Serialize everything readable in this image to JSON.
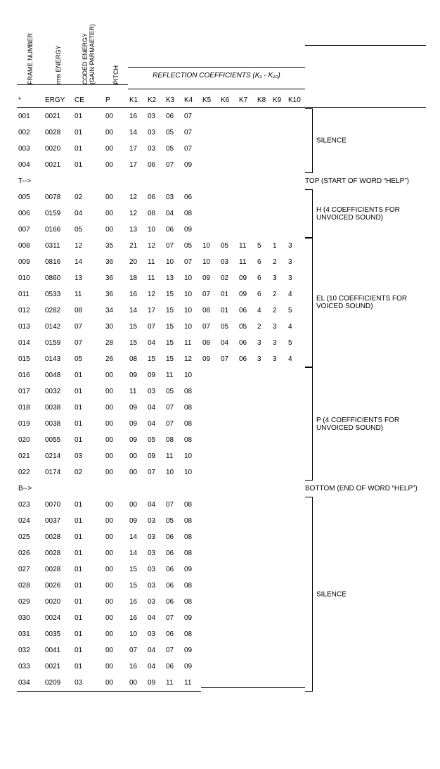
{
  "headers": {
    "frame": "FRAME NUMBER",
    "ergy": "rms ENERGY",
    "ce": "CODED ENERGY\n(GAIN PARMAETER)",
    "pitch": "PITCH",
    "refl": "REFLECTION COEFFICIENTS  (K₁ - K₁₀)",
    "sub": {
      "frame": "*",
      "ergy": "ERGY",
      "ce": "CE",
      "p": "P"
    },
    "k": [
      "K1",
      "K2",
      "K3",
      "K4",
      "K5",
      "K6",
      "K7",
      "K8",
      "K9",
      "K10"
    ]
  },
  "sections": [
    {
      "label": "SILENCE",
      "rows": [
        {
          "f": "001",
          "e": "0021",
          "c": "01",
          "p": "00",
          "k": [
            "16",
            "03",
            "06",
            "07"
          ]
        },
        {
          "f": "002",
          "e": "0028",
          "c": "01",
          "p": "00",
          "k": [
            "14",
            "03",
            "05",
            "07"
          ]
        },
        {
          "f": "003",
          "e": "0020",
          "c": "01",
          "p": "00",
          "k": [
            "17",
            "03",
            "05",
            "07"
          ]
        },
        {
          "f": "004",
          "e": "0021",
          "c": "01",
          "p": "00",
          "k": [
            "17",
            "06",
            "07",
            "09"
          ]
        }
      ]
    },
    {
      "marker": {
        "left": "T-->",
        "right": "TOP (START OF WORD “HELP”)"
      }
    },
    {
      "label": "H (4 COEFFICIENTS FOR UNVOICED SOUND)",
      "rows": [
        {
          "f": "005",
          "e": "0078",
          "c": "02",
          "p": "00",
          "k": [
            "12",
            "06",
            "03",
            "06"
          ]
        },
        {
          "f": "006",
          "e": "0159",
          "c": "04",
          "p": "00",
          "k": [
            "12",
            "08",
            "04",
            "08"
          ]
        },
        {
          "f": "007",
          "e": "0166",
          "c": "05",
          "p": "00",
          "k": [
            "13",
            "10",
            "06",
            "09"
          ]
        }
      ]
    },
    {
      "label": "EL (10 COEFFICIENTS FOR VOICED SOUND)",
      "rows": [
        {
          "f": "008",
          "e": "0311",
          "c": "12",
          "p": "35",
          "k": [
            "21",
            "12",
            "07",
            "05",
            "10",
            "05",
            "11",
            "5",
            "1",
            "3"
          ]
        },
        {
          "f": "009",
          "e": "0816",
          "c": "14",
          "p": "36",
          "k": [
            "20",
            "11",
            "10",
            "07",
            "10",
            "03",
            "11",
            "6",
            "2",
            "3"
          ]
        },
        {
          "f": "010",
          "e": "0860",
          "c": "13",
          "p": "36",
          "k": [
            "18",
            "11",
            "13",
            "10",
            "09",
            "02",
            "09",
            "6",
            "3",
            "3"
          ]
        },
        {
          "f": "011",
          "e": "0533",
          "c": "11",
          "p": "36",
          "k": [
            "16",
            "12",
            "15",
            "10",
            "07",
            "01",
            "09",
            "6",
            "2",
            "4"
          ]
        },
        {
          "f": "012",
          "e": "0282",
          "c": "08",
          "p": "34",
          "k": [
            "14",
            "17",
            "15",
            "10",
            "08",
            "01",
            "06",
            "4",
            "2",
            "5"
          ]
        },
        {
          "f": "013",
          "e": "0142",
          "c": "07",
          "p": "30",
          "k": [
            "15",
            "07",
            "15",
            "10",
            "07",
            "05",
            "05",
            "2",
            "3",
            "4"
          ]
        },
        {
          "f": "014",
          "e": "0159",
          "c": "07",
          "p": "28",
          "k": [
            "15",
            "04",
            "15",
            "11",
            "08",
            "04",
            "06",
            "3",
            "3",
            "5"
          ]
        },
        {
          "f": "015",
          "e": "0143",
          "c": "05",
          "p": "26",
          "k": [
            "08",
            "15",
            "15",
            "12",
            "09",
            "07",
            "06",
            "3",
            "3",
            "4"
          ]
        }
      ]
    },
    {
      "label": "P (4 COEFFICIENTS FOR UNVOICED SOUND)",
      "rows": [
        {
          "f": "016",
          "e": "0048",
          "c": "01",
          "p": "00",
          "k": [
            "09",
            "09",
            "11",
            "10"
          ]
        },
        {
          "f": "017",
          "e": "0032",
          "c": "01",
          "p": "00",
          "k": [
            "11",
            "03",
            "05",
            "08"
          ]
        },
        {
          "f": "018",
          "e": "0038",
          "c": "01",
          "p": "00",
          "k": [
            "09",
            "04",
            "07",
            "08"
          ]
        },
        {
          "f": "019",
          "e": "0038",
          "c": "01",
          "p": "00",
          "k": [
            "09",
            "04",
            "07",
            "08"
          ]
        },
        {
          "f": "020",
          "e": "0055",
          "c": "01",
          "p": "00",
          "k": [
            "09",
            "05",
            "08",
            "08"
          ]
        },
        {
          "f": "021",
          "e": "0214",
          "c": "03",
          "p": "00",
          "k": [
            "00",
            "09",
            "11",
            "10"
          ]
        },
        {
          "f": "022",
          "e": "0174",
          "c": "02",
          "p": "00",
          "k": [
            "00",
            "07",
            "10",
            "10"
          ]
        }
      ]
    },
    {
      "marker": {
        "left": "B-->",
        "right": "BOTTOM (END OF WORD “HELP”)"
      }
    },
    {
      "label": "SILENCE",
      "rows": [
        {
          "f": "023",
          "e": "0070",
          "c": "01",
          "p": "00",
          "k": [
            "00",
            "04",
            "07",
            "08"
          ]
        },
        {
          "f": "024",
          "e": "0037",
          "c": "01",
          "p": "00",
          "k": [
            "09",
            "03",
            "05",
            "08"
          ]
        },
        {
          "f": "025",
          "e": "0028",
          "c": "01",
          "p": "00",
          "k": [
            "14",
            "03",
            "06",
            "08"
          ]
        },
        {
          "f": "026",
          "e": "0028",
          "c": "01",
          "p": "00",
          "k": [
            "14",
            "03",
            "06",
            "08"
          ]
        },
        {
          "f": "027",
          "e": "0028",
          "c": "01",
          "p": "00",
          "k": [
            "15",
            "03",
            "06",
            "09"
          ]
        },
        {
          "f": "028",
          "e": "0026",
          "c": "01",
          "p": "00",
          "k": [
            "15",
            "03",
            "06",
            "08"
          ]
        },
        {
          "f": "029",
          "e": "0020",
          "c": "01",
          "p": "00",
          "k": [
            "16",
            "03",
            "06",
            "08"
          ]
        },
        {
          "f": "030",
          "e": "0024",
          "c": "01",
          "p": "00",
          "k": [
            "16",
            "04",
            "07",
            "09"
          ]
        },
        {
          "f": "031",
          "e": "0035",
          "c": "01",
          "p": "00",
          "k": [
            "10",
            "03",
            "06",
            "08"
          ]
        },
        {
          "f": "032",
          "e": "0041",
          "c": "01",
          "p": "00",
          "k": [
            "07",
            "04",
            "07",
            "09"
          ]
        },
        {
          "f": "033",
          "e": "0021",
          "c": "01",
          "p": "00",
          "k": [
            "16",
            "04",
            "06",
            "09"
          ]
        },
        {
          "f": "034",
          "e": "0209",
          "c": "03",
          "p": "00",
          "k": [
            "00",
            "09",
            "11",
            "11"
          ]
        }
      ]
    }
  ]
}
